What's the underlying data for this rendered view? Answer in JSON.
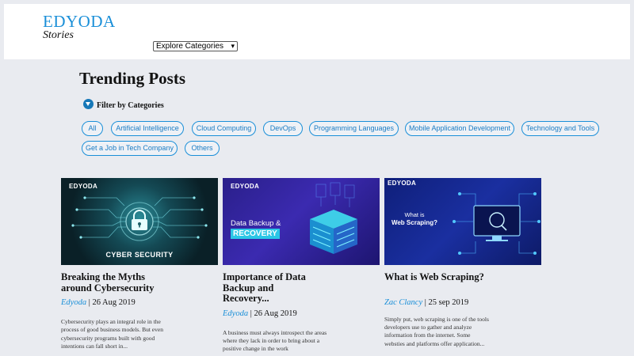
{
  "header": {
    "brand": "EDYODA",
    "tagline": "Stories",
    "category_select": "Explore Categories"
  },
  "trending": {
    "title": "Trending Posts",
    "filter_label": "Filter by Categories",
    "chips": [
      "All",
      "Artificial Intelligence",
      "Cloud Computing",
      "DevOps",
      "Programming Languages",
      "Mobile Application Development",
      "Technology and Tools",
      "Get a Job in Tech Company",
      "Others"
    ]
  },
  "posts": [
    {
      "thumb_brand": "EDYODA",
      "thumb_caption": "CYBER SECURITY",
      "title": "Breaking the Myths around Cybersecurity",
      "author": "Edyoda",
      "date": "26 Aug 2019",
      "excerpt": "Cybersecurity plays an integral role in the process of good business models. But even cybersecurity programs built with good intentions can fall short in..."
    },
    {
      "thumb_brand": "EDYODA",
      "thumb_caption_1": "Data Backup &",
      "thumb_caption_2": "RECOVERY",
      "title": "Importance of Data Backup and Recovery...",
      "author": "Edyoda",
      "date": "26 Aug 2019",
      "excerpt": "A business must always introspect the areas where they lack in order to bring about a positive change in the work"
    },
    {
      "thumb_brand": "EDYODA",
      "thumb_caption_1": "What is",
      "thumb_caption_2": "Web Scraping?",
      "title": "What is Web Scraping?",
      "author": "Zac Clancy",
      "date": "25 sep 2019",
      "excerpt": "Simply put, web scraping is one of the tools developers use to gather and analyze information from the internet. Some websties and platforms offer application..."
    }
  ]
}
